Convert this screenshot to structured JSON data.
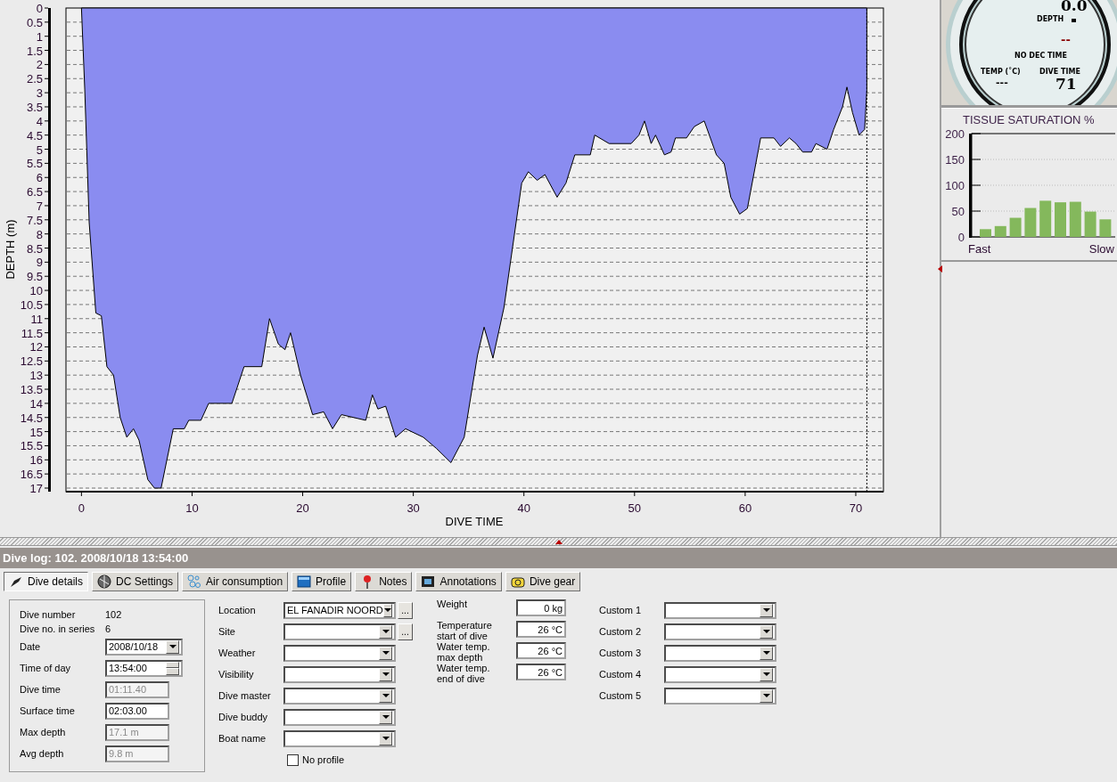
{
  "depth_chart": {
    "chart_data": {
      "type": "area",
      "xlabel": "DIVE TIME",
      "ylabel": "DEPTH (m)",
      "x": [
        0,
        0.3,
        0.7,
        1.3,
        1.8,
        2.3,
        2.9,
        3.5,
        4.1,
        4.7,
        5.2,
        6.0,
        6.6,
        7.2,
        8.3,
        9.3,
        9.7,
        10.8,
        11.5,
        13.6,
        14.7,
        16.3,
        17,
        17.8,
        18.4,
        18.9,
        19.8,
        20.9,
        21.9,
        22.7,
        23.5,
        25.7,
        26.3,
        26.8,
        27.5,
        28.4,
        29.3,
        30.9,
        32.1,
        33.4,
        34.6,
        35.8,
        36.4,
        37.2,
        38.2,
        39.8,
        40.4,
        41.2,
        41.9,
        43,
        43.8,
        44.6,
        46,
        46.4,
        47.7,
        49.7,
        50.4,
        50.9,
        51.5,
        51.9,
        52.7,
        53.3,
        53.7,
        54.7,
        55.4,
        56.3,
        57.4,
        58.1,
        58.7,
        59.5,
        60.2,
        61.4,
        62.6,
        63.2,
        64,
        64.6,
        65.2,
        66,
        66.4,
        67.4,
        68,
        68.8,
        69.2,
        69.7,
        70.3,
        70.8,
        71
      ],
      "series": [
        {
          "color": "#8a8cf0",
          "values": [
            0,
            2.9,
            7.6,
            10.8,
            10.9,
            12.7,
            13,
            14.5,
            15.2,
            14.9,
            15.3,
            16.7,
            17,
            17,
            14.9,
            14.9,
            14.6,
            14.6,
            14,
            14,
            12.7,
            12.7,
            11,
            11.9,
            12.1,
            11.5,
            13,
            14.4,
            14.3,
            14.9,
            14.4,
            14.6,
            13.7,
            14.2,
            14.1,
            15.2,
            14.9,
            15.2,
            15.6,
            16.1,
            15.2,
            12.3,
            11.3,
            12.4,
            10.6,
            6.2,
            5.8,
            6.1,
            5.9,
            6.7,
            6.2,
            5.2,
            5.2,
            4.5,
            4.8,
            4.8,
            4.5,
            4,
            4.8,
            4.5,
            5.2,
            5.1,
            4.6,
            4.6,
            4.2,
            4,
            5.2,
            5.5,
            6.7,
            7.3,
            7.1,
            4.6,
            4.6,
            4.9,
            4.6,
            4.8,
            5.1,
            5.1,
            4.8,
            5,
            4.3,
            3.5,
            2.8,
            3.7,
            4.5,
            4.3,
            2.9
          ]
        }
      ],
      "xlim": [
        -1.4,
        72.5
      ],
      "ylim": [
        17,
        0
      ],
      "grid": true,
      "ref_lines": [
        {
          "axis": "x",
          "value": 71
        }
      ],
      "xticks": [
        0,
        10,
        20,
        30,
        40,
        50,
        60,
        70
      ],
      "yticks": [
        0,
        0.5,
        1,
        1.5,
        2,
        2.5,
        3,
        3.5,
        4,
        4.5,
        5,
        5.5,
        6,
        6.5,
        7,
        7.5,
        8,
        8.5,
        9,
        9.5,
        10,
        10.5,
        11,
        11.5,
        12,
        12.5,
        13,
        13.5,
        14,
        14.5,
        15,
        15.5,
        16,
        16.5,
        17
      ]
    }
  },
  "gauge": {
    "depth_value": "0.0",
    "depth_label": "DEPTH",
    "no_dec_value": "--",
    "no_dec_label": "NO DEC TIME",
    "temp_label": "TEMP (˚C)",
    "temp_value": "---",
    "dive_time_label": "DIVE TIME",
    "dive_time_value": "71"
  },
  "tissue_saturation": {
    "chart_data": {
      "type": "bar",
      "title": "TISSUE SATURATION %",
      "series": [
        {
          "color": "#84b85c",
          "values": [
            15,
            21,
            37,
            56,
            70,
            67,
            68,
            49,
            34
          ]
        }
      ],
      "ylim": [
        0,
        200
      ],
      "grid": true,
      "yticks": [
        0,
        50,
        100,
        150,
        200
      ],
      "annotations": [
        {
          "text": "Fast"
        },
        {
          "text": "Slow"
        }
      ]
    }
  },
  "dive_log": {
    "title": "Dive log: 102. 2008/10/18 13:54:00",
    "tabs": [
      {
        "label": "Dive details",
        "selected": true
      },
      {
        "label": "DC Settings",
        "selected": false
      },
      {
        "label": "Air consumption",
        "selected": false
      },
      {
        "label": "Profile",
        "selected": false
      },
      {
        "label": "Notes",
        "selected": false
      },
      {
        "label": "Annotations",
        "selected": false
      },
      {
        "label": "Dive gear",
        "selected": false
      }
    ],
    "summary": [
      {
        "label": "Dive number",
        "value": "102",
        "kind": "info"
      },
      {
        "label": "Dive no. in series",
        "value": "6",
        "kind": "info"
      },
      {
        "label": "Date",
        "value": "2008/10/18",
        "kind": "dropdown"
      },
      {
        "label": "Time of day",
        "value": "13:54:00",
        "kind": "spin"
      },
      {
        "label": "Dive time",
        "value": "01:11.40",
        "kind": "readonly"
      },
      {
        "label": "Surface time",
        "value": "02:03.00",
        "kind": "text"
      },
      {
        "label": "Max depth",
        "value": "17.1 m",
        "kind": "readonly"
      },
      {
        "label": "Avg depth",
        "value": "9.8 m",
        "kind": "readonly"
      }
    ],
    "details": [
      {
        "label": "Location",
        "value": "EL FANADIR NOORD",
        "browse": "..."
      },
      {
        "label": "Site",
        "browse": "..."
      },
      {
        "label": "Weather"
      },
      {
        "label": "Visibility"
      },
      {
        "label": "Dive master"
      },
      {
        "label": "Dive buddy"
      },
      {
        "label": "Boat name"
      }
    ],
    "no_profile": {
      "label": "No profile",
      "checked": false
    },
    "measurements": [
      {
        "label": "Weight",
        "value": "0 kg"
      },
      {
        "label": "Temperature start of dive",
        "value": "26 °C"
      },
      {
        "label": "Water temp. max depth",
        "value": "26 °C"
      },
      {
        "label": "Water temp. end of dive",
        "value": "26 °C"
      }
    ],
    "custom": [
      {
        "label": "Custom 1"
      },
      {
        "label": "Custom 2"
      },
      {
        "label": "Custom 3"
      },
      {
        "label": "Custom 4"
      },
      {
        "label": "Custom 5"
      }
    ]
  }
}
